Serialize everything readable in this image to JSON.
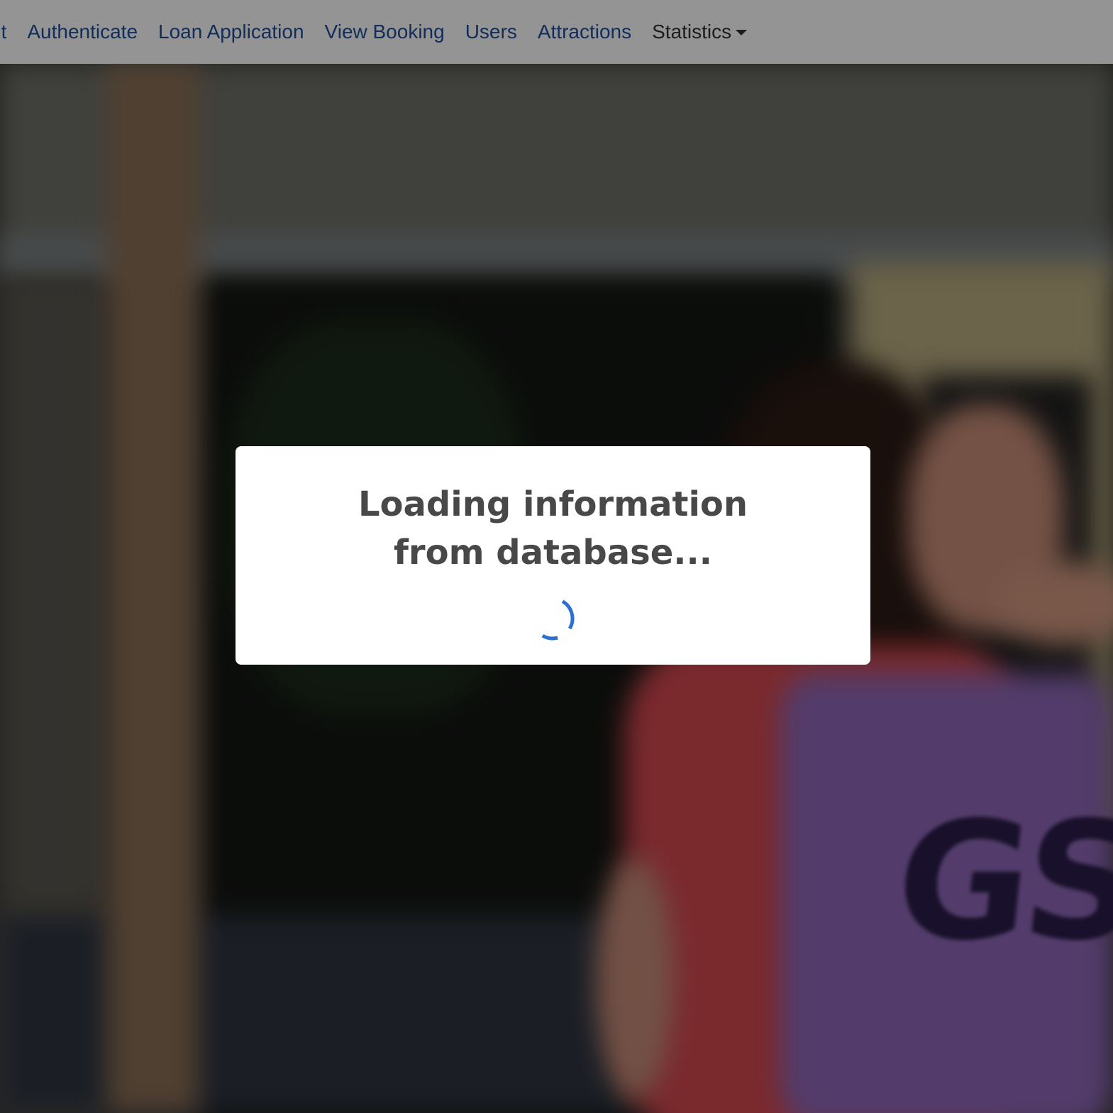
{
  "navbar": {
    "items": [
      {
        "label": "ut"
      },
      {
        "label": "Authenticate"
      },
      {
        "label": "Loan Application"
      },
      {
        "label": "View Booking"
      },
      {
        "label": "Users"
      },
      {
        "label": "Attractions"
      }
    ],
    "dropdown": {
      "label": "Statistics",
      "icon": "caret-down-icon"
    }
  },
  "modal": {
    "title": "Loading information from database...",
    "spinner_icon": "loading-spinner-icon"
  },
  "hero": {
    "bib_text": "GS"
  },
  "colors": {
    "nav_link": "#1f4e9c",
    "spinner": "#2a6fd1",
    "modal_text": "#484848"
  }
}
